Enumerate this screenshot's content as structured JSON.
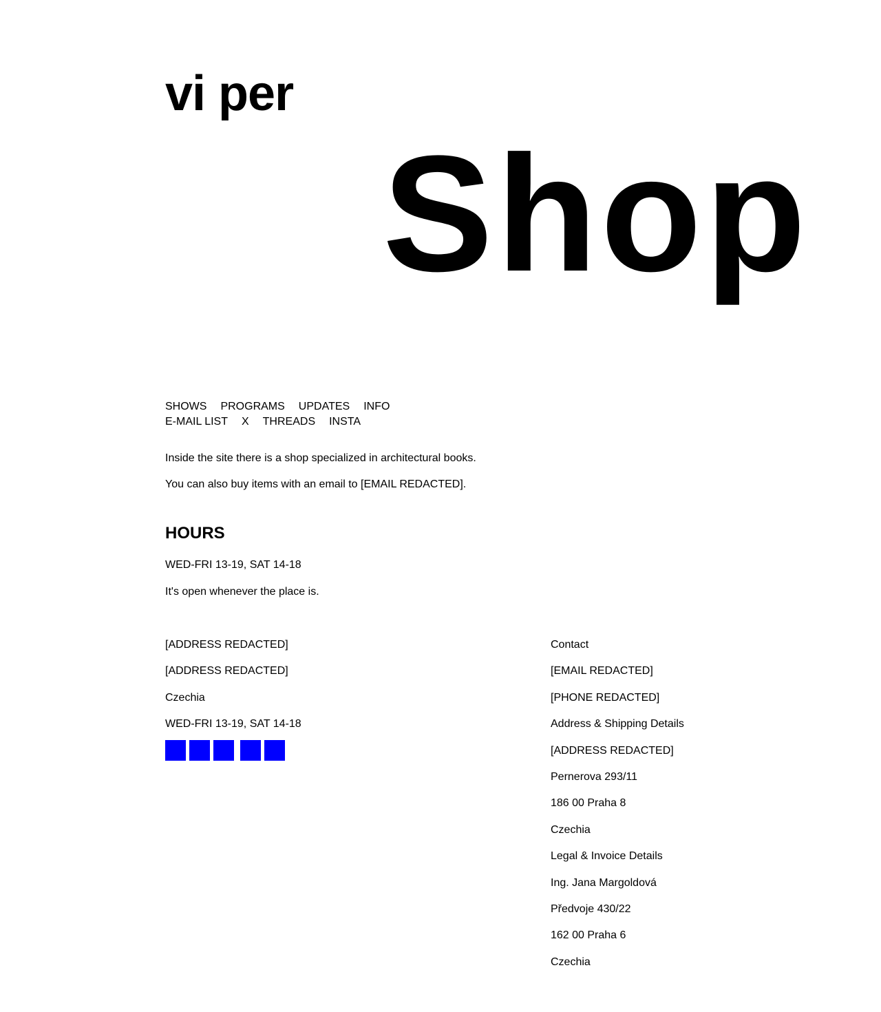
{
  "site": {
    "logo": "vi per",
    "page_title": "Shop"
  },
  "nav": {
    "row1": [
      "SHOWS",
      "PROGRAMS",
      "UPDATES",
      "INFO"
    ],
    "row2": [
      "E-MAIL LIST",
      "X",
      "THREADS",
      "INSTA"
    ]
  },
  "intro": {
    "line1": "Inside the site there is a shop specialized in architectural books.",
    "line2": "You can also buy items with an email to [EMAIL REDACTED]."
  },
  "hours": {
    "heading": "HOURS",
    "times": "WED-FRI 13-19, SAT 14-18",
    "note": "It's open whenever the place is."
  },
  "footer_left": {
    "address1": "[ADDRESS REDACTED]",
    "address2": "[ADDRESS REDACTED]",
    "country": "Czechia",
    "hours": "WED-FRI 13-19, SAT 14-18",
    "social_color": "#0000ff"
  },
  "footer_right": {
    "contact_label": "Contact",
    "email": "[EMAIL REDACTED]",
    "phone": "[PHONE REDACTED]",
    "shipping_label": "Address & Shipping Details",
    "shipping_line1": "[ADDRESS REDACTED]",
    "shipping_line2": "Pernerova 293/11",
    "shipping_line3": "186 00 Praha 8",
    "shipping_country": "Czechia",
    "legal_label": "Legal & Invoice Details",
    "legal_name": "Ing. Jana Margoldová",
    "legal_street": "Předvoje 430/22",
    "legal_city": "162 00 Praha 6",
    "legal_country": "Czechia"
  }
}
